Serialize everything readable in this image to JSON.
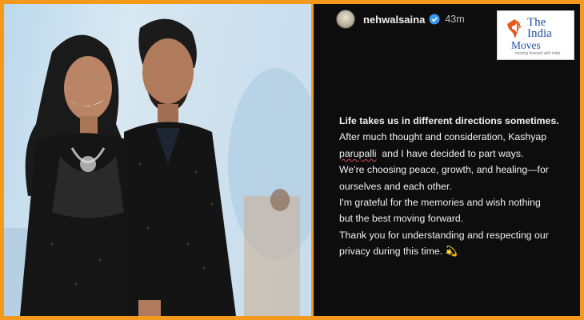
{
  "story": {
    "handle": "nehwalsaina",
    "time": "43m",
    "lines": [
      "Life takes us in different directions sometimes.",
      "After much thought and consideration, Kashyap",
      "parupalli",
      "and I have decided to part ways.",
      "We're choosing peace, growth, and healing—for",
      "ourselves and each other.",
      "I'm grateful for the memories and wish nothing",
      "but the best moving forward.",
      "Thank you for understanding and respecting our",
      "privacy during this time.",
      "💫"
    ]
  },
  "logo": {
    "line1": "The",
    "line2": "India",
    "line3": "Moves",
    "tagline": "moving forward with india"
  },
  "colors": {
    "frame": "#f39a1c",
    "story_bg": "#0d0d0d",
    "logo_blue": "#1d4ea0",
    "logo_orange": "#e9591f"
  }
}
